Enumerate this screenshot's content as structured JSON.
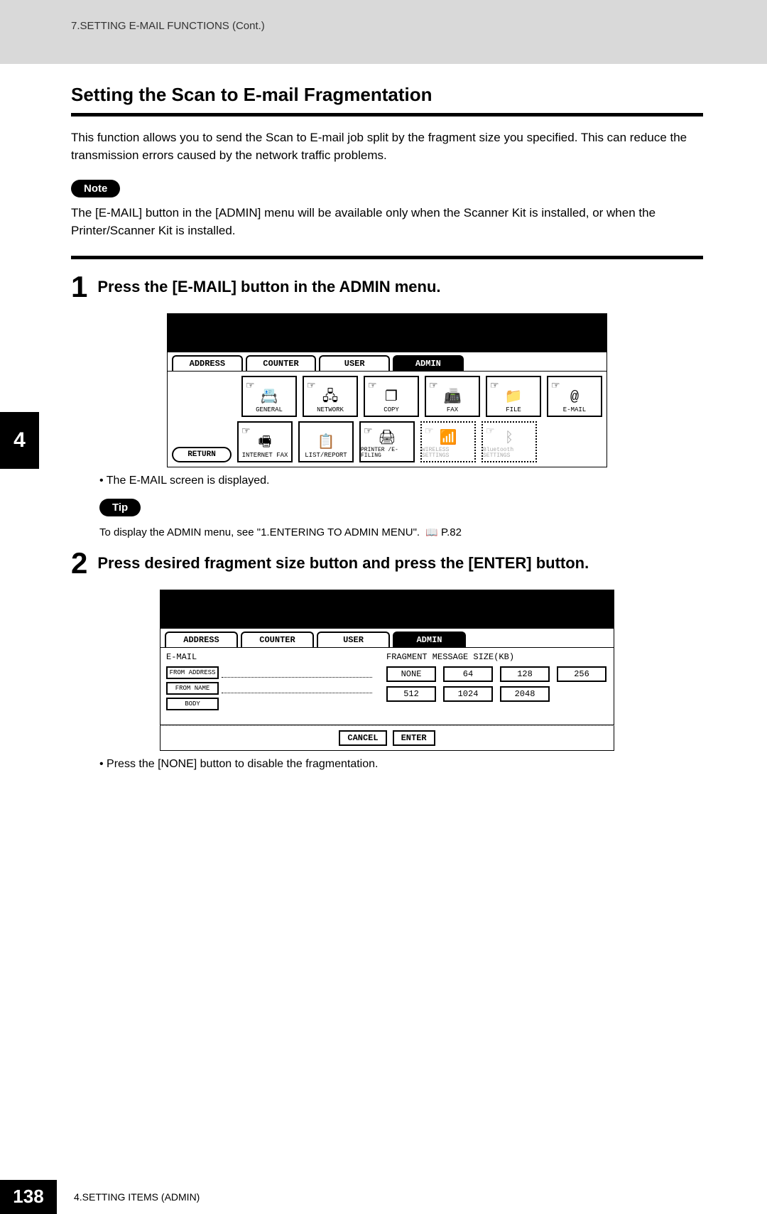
{
  "header": {
    "breadcrumb": "7.SETTING E-MAIL FUNCTIONS (Cont.)"
  },
  "chapter_tab": "4",
  "section": {
    "title": "Setting the Scan to E-mail Fragmentation",
    "intro": "This function allows you to send the Scan to E-mail job split by the fragment size you specified.  This can reduce the transmission errors caused by the network traffic problems."
  },
  "note": {
    "pill": "Note",
    "text": "The [E-MAIL] button in the [ADMIN] menu will be available only when the Scanner Kit is installed, or when the Printer/Scanner Kit is installed."
  },
  "steps": [
    {
      "num": "1",
      "title": "Press the [E-MAIL] button in the ADMIN menu.",
      "bullet": "The E-MAIL screen is displayed."
    },
    {
      "num": "2",
      "title": "Press desired fragment size button and press the [ENTER] button.",
      "bullet": "Press the [NONE] button to disable the fragmentation."
    }
  ],
  "tip": {
    "pill": "Tip",
    "text": "To display the ADMIN menu, see \"1.ENTERING TO ADMIN MENU\".",
    "page_ref": "P.82"
  },
  "screen1": {
    "tabs": [
      "ADDRESS",
      "COUNTER",
      "USER",
      "ADMIN"
    ],
    "active_tab": "ADMIN",
    "row1": [
      {
        "label": "GENERAL",
        "icon": "📇"
      },
      {
        "label": "NETWORK",
        "icon": "🖧"
      },
      {
        "label": "COPY",
        "icon": "❐"
      },
      {
        "label": "FAX",
        "icon": "📠"
      },
      {
        "label": "FILE",
        "icon": "📁"
      },
      {
        "label": "E-MAIL",
        "icon": "@"
      }
    ],
    "row2": [
      {
        "label": "INTERNET FAX",
        "icon": "🖷",
        "disabled": false
      },
      {
        "label": "LIST/REPORT",
        "icon": "📋",
        "disabled": false
      },
      {
        "label": "PRINTER /E-FILING",
        "icon": "🖨",
        "disabled": false
      },
      {
        "label": "WIRELESS SETTINGS",
        "icon": "📶",
        "disabled": true
      },
      {
        "label": "Bluetooth SETTINGS",
        "icon": "ᛒ",
        "disabled": true
      }
    ],
    "return": "RETURN"
  },
  "screen2": {
    "tabs": [
      "ADDRESS",
      "COUNTER",
      "USER",
      "ADMIN"
    ],
    "active_tab": "ADMIN",
    "section_label": "E-MAIL",
    "left_buttons": [
      "FROM ADDRESS",
      "FROM NAME",
      "BODY"
    ],
    "fragment_label": "FRAGMENT MESSAGE SIZE(KB)",
    "sizes_row1": [
      "NONE",
      "64",
      "128",
      "256"
    ],
    "sizes_row2": [
      "512",
      "1024",
      "2048"
    ],
    "cancel": "CANCEL",
    "enter": "ENTER"
  },
  "footer": {
    "page": "138",
    "chapter": "4.SETTING ITEMS (ADMIN)"
  }
}
